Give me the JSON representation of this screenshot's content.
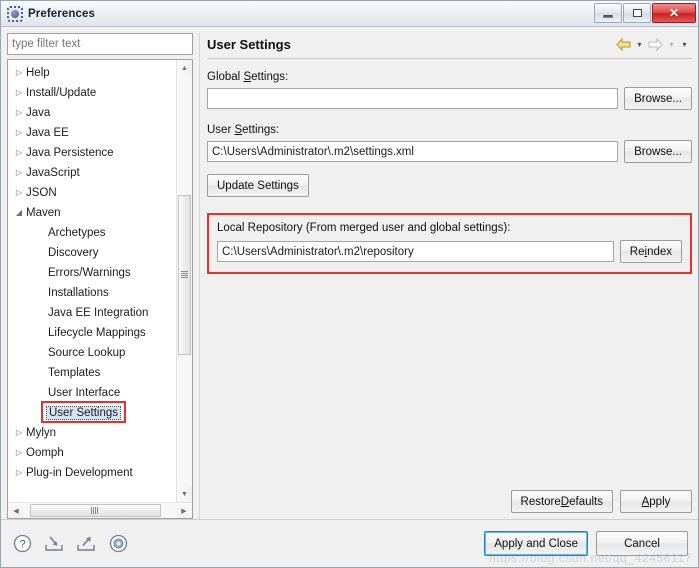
{
  "window": {
    "title": "Preferences",
    "icon": "preferences-icon",
    "controls": {
      "minimize": "minimize-button",
      "maximize": "maximize-button",
      "close_glyph": "✕"
    }
  },
  "sidebar": {
    "filter": {
      "placeholder": "type filter text",
      "value": ""
    },
    "items": [
      {
        "label": "Help",
        "level": 0,
        "arrow": "collapsed"
      },
      {
        "label": "Install/Update",
        "level": 0,
        "arrow": "collapsed"
      },
      {
        "label": "Java",
        "level": 0,
        "arrow": "collapsed"
      },
      {
        "label": "Java EE",
        "level": 0,
        "arrow": "collapsed"
      },
      {
        "label": "Java Persistence",
        "level": 0,
        "arrow": "collapsed"
      },
      {
        "label": "JavaScript",
        "level": 0,
        "arrow": "collapsed"
      },
      {
        "label": "JSON",
        "level": 0,
        "arrow": "collapsed"
      },
      {
        "label": "Maven",
        "level": 0,
        "arrow": "expanded"
      },
      {
        "label": "Archetypes",
        "level": 1,
        "arrow": "none"
      },
      {
        "label": "Discovery",
        "level": 1,
        "arrow": "none"
      },
      {
        "label": "Errors/Warnings",
        "level": 1,
        "arrow": "none"
      },
      {
        "label": "Installations",
        "level": 1,
        "arrow": "none"
      },
      {
        "label": "Java EE Integration",
        "level": 1,
        "arrow": "none"
      },
      {
        "label": "Lifecycle Mappings",
        "level": 1,
        "arrow": "none"
      },
      {
        "label": "Source Lookup",
        "level": 1,
        "arrow": "none"
      },
      {
        "label": "Templates",
        "level": 1,
        "arrow": "none"
      },
      {
        "label": "User Interface",
        "level": 1,
        "arrow": "none"
      },
      {
        "label": "User Settings",
        "level": 1,
        "arrow": "none",
        "selected": true,
        "annotated": true
      },
      {
        "label": "Mylyn",
        "level": 0,
        "arrow": "collapsed"
      },
      {
        "label": "Oomph",
        "level": 0,
        "arrow": "collapsed"
      },
      {
        "label": "Plug-in Development",
        "level": 0,
        "arrow": "collapsed"
      }
    ],
    "scroll": {
      "up_arrow": "▲",
      "down_arrow": "▼",
      "left_arrow": "◀",
      "right_arrow": "▶"
    }
  },
  "page": {
    "title": "User Settings",
    "nav": {
      "back": "back-arrow",
      "back_menu": "▾",
      "forward": "forward-arrow",
      "forward_menu": "▾",
      "view_menu": "▾"
    },
    "global_settings": {
      "label_pre": "Global ",
      "label_accel": "S",
      "label_post": "ettings:",
      "value": "",
      "browse_label": "Browse..."
    },
    "user_settings": {
      "label_pre": "User ",
      "label_accel": "S",
      "label_post": "ettings:",
      "value": "C:\\Users\\Administrator\\.m2\\settings.xml",
      "browse_label": "Browse...",
      "update_label": "Update Settings"
    },
    "local_repository": {
      "label": "Local Repository (From merged user and global settings):",
      "value": "C:\\Users\\Administrator\\.m2\\repository",
      "reindex_pre": "Re",
      "reindex_accel": "i",
      "reindex_post": "ndex",
      "annotated": true
    },
    "actions": {
      "restore_pre": "Restore ",
      "restore_accel": "D",
      "restore_post": "efaults",
      "apply_pre": "",
      "apply_accel": "A",
      "apply_post": "pply"
    }
  },
  "footer": {
    "icons": [
      {
        "name": "help-icon"
      },
      {
        "name": "import-icon"
      },
      {
        "name": "export-icon"
      },
      {
        "name": "oomph-recorder-icon"
      }
    ],
    "apply_and_close": "Apply and Close",
    "cancel": "Cancel"
  },
  "watermark": "https://blog.csdn.net/qq_42456117",
  "colors": {
    "annotation_red": "#e8302a",
    "selection_blue": "#d6e3f5",
    "focus_blue": "#2f7fc4",
    "back_arrow_gold": "#e8c66a",
    "window_bg": "#f0f0f0"
  }
}
